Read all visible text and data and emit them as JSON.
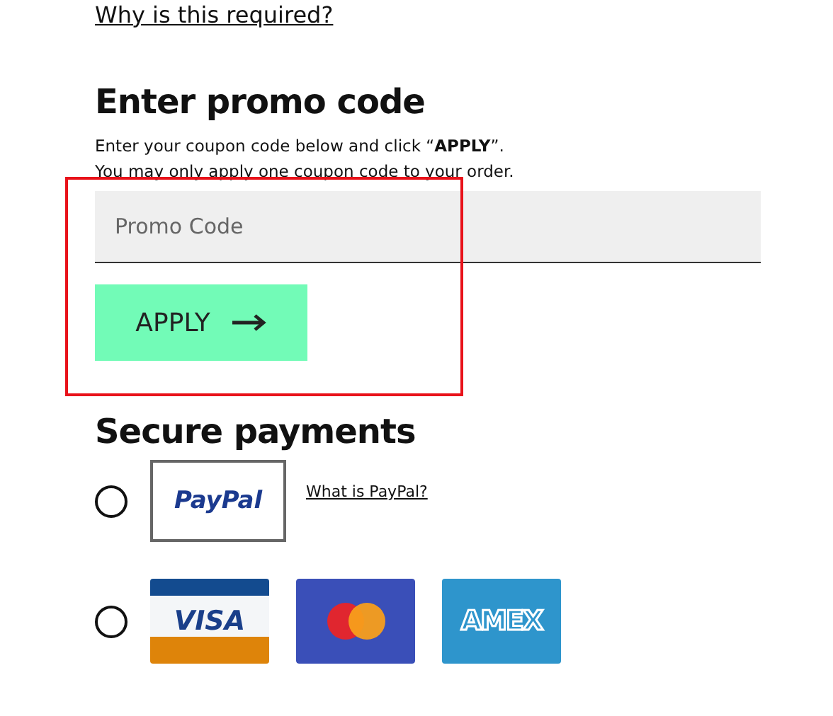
{
  "top_link": "Why is this required?",
  "promo": {
    "title": "Enter promo code",
    "instructions": [
      "Enter your coupon code below and click “**APPLY**”.",
      "You may only apply one coupon code to your order."
    ],
    "field": {
      "placeholder": "Promo Code"
    },
    "button": "APPLY",
    "highlighted": true
  },
  "payments": {
    "title": "Secure payments",
    "options": [
      {
        "selected": false,
        "logos": [
          {
            "kind": "paypal",
            "text": "PayPal"
          }
        ],
        "link": "What is PayPal?"
      },
      {
        "selected": false,
        "logos": [
          {
            "kind": "visa",
            "text": "VISA"
          },
          {
            "kind": "mastercard"
          },
          {
            "kind": "amex",
            "text": "AMEX"
          }
        ]
      }
    ]
  }
}
